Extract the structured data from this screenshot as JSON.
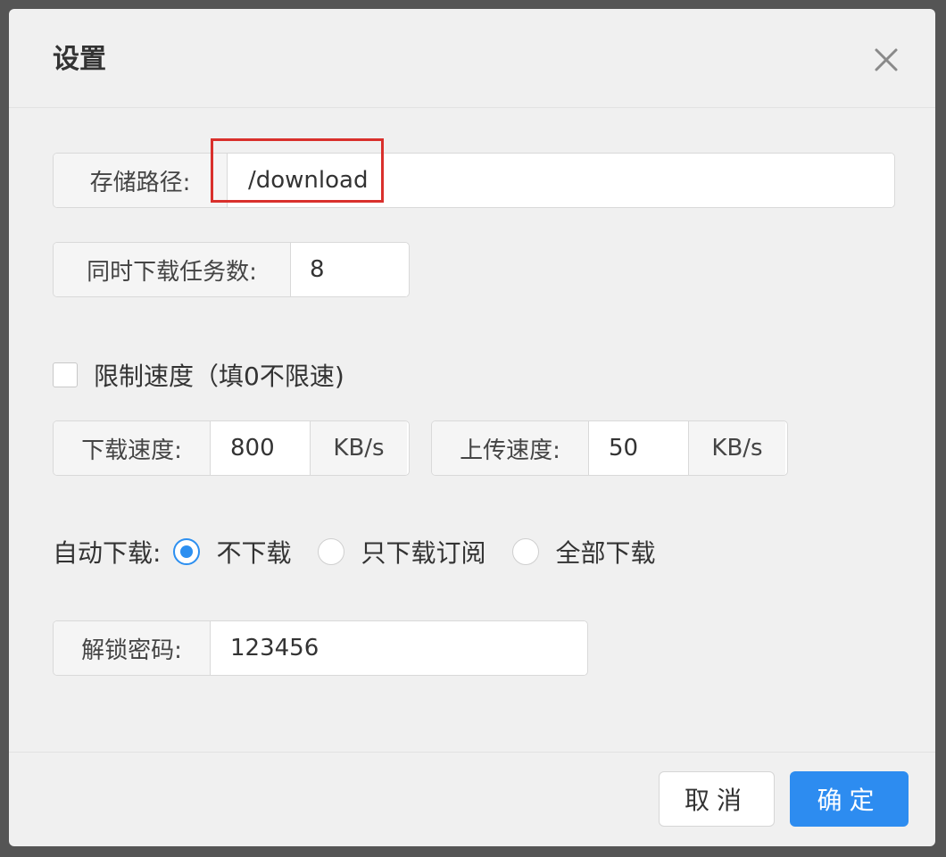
{
  "dialog": {
    "title": "设置",
    "close_icon": "close-icon"
  },
  "storage": {
    "label": "存储路径:",
    "value": "/download"
  },
  "concurrent": {
    "label": "同时下载任务数:",
    "value": "8"
  },
  "limit_speed": {
    "label": "限制速度（填0不限速)",
    "checked": false
  },
  "download_speed": {
    "label": "下载速度:",
    "value": "800",
    "unit": "KB/s"
  },
  "upload_speed": {
    "label": "上传速度:",
    "value": "50",
    "unit": "KB/s"
  },
  "auto_download": {
    "label": "自动下载:",
    "options": [
      {
        "label": "不下载",
        "checked": true
      },
      {
        "label": "只下载订阅",
        "checked": false
      },
      {
        "label": "全部下载",
        "checked": false
      }
    ]
  },
  "unlock": {
    "label": "解锁密码:",
    "value": "123456"
  },
  "footer": {
    "cancel_label": "取消",
    "ok_label": "确定"
  },
  "colors": {
    "primary": "#2d8cf0",
    "highlight": "#d9302c"
  }
}
